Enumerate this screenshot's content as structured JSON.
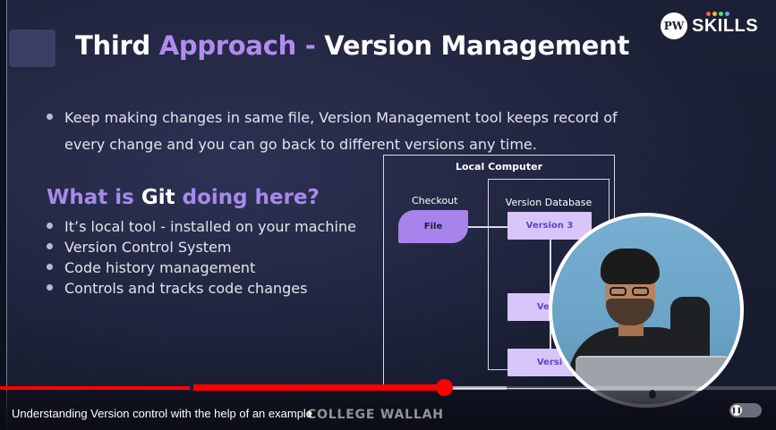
{
  "slide": {
    "title_part1": "Third",
    "title_part2": "Approach -",
    "title_part3": "Version Management",
    "logo_mark": "PW",
    "logo_text": "SKILLS",
    "bullet_main_line1": "Keep making changes in same file, Version Management tool keeps record of",
    "bullet_main_line2": "every change and you can go back to different versions any time.",
    "subhead_part1": "What is",
    "subhead_part2": "Git",
    "subhead_part3": "doing here?",
    "points": [
      "It’s local tool - installed on your machine",
      "Version Control System",
      "Code history management",
      "Controls and tracks code changes"
    ],
    "colors": {
      "accent_purple": "#b18cf0",
      "background": "#1a1e33",
      "version_box": "#d8c5f9"
    }
  },
  "diagram": {
    "title": "Local Computer",
    "checkout_label": "Checkout",
    "file_label": "File",
    "database_label": "Version Database",
    "versions": [
      "Version 3",
      "Versi",
      "Versi"
    ]
  },
  "player": {
    "chapter_title": "Understanding Version control with the help of an example",
    "chapter_chevron": "›",
    "watermark": "COLLEGE WALLAH",
    "progress_played_fraction": 0.573,
    "progress_buffered_fraction": 0.653,
    "colors": {
      "played": "#ff0000"
    }
  }
}
